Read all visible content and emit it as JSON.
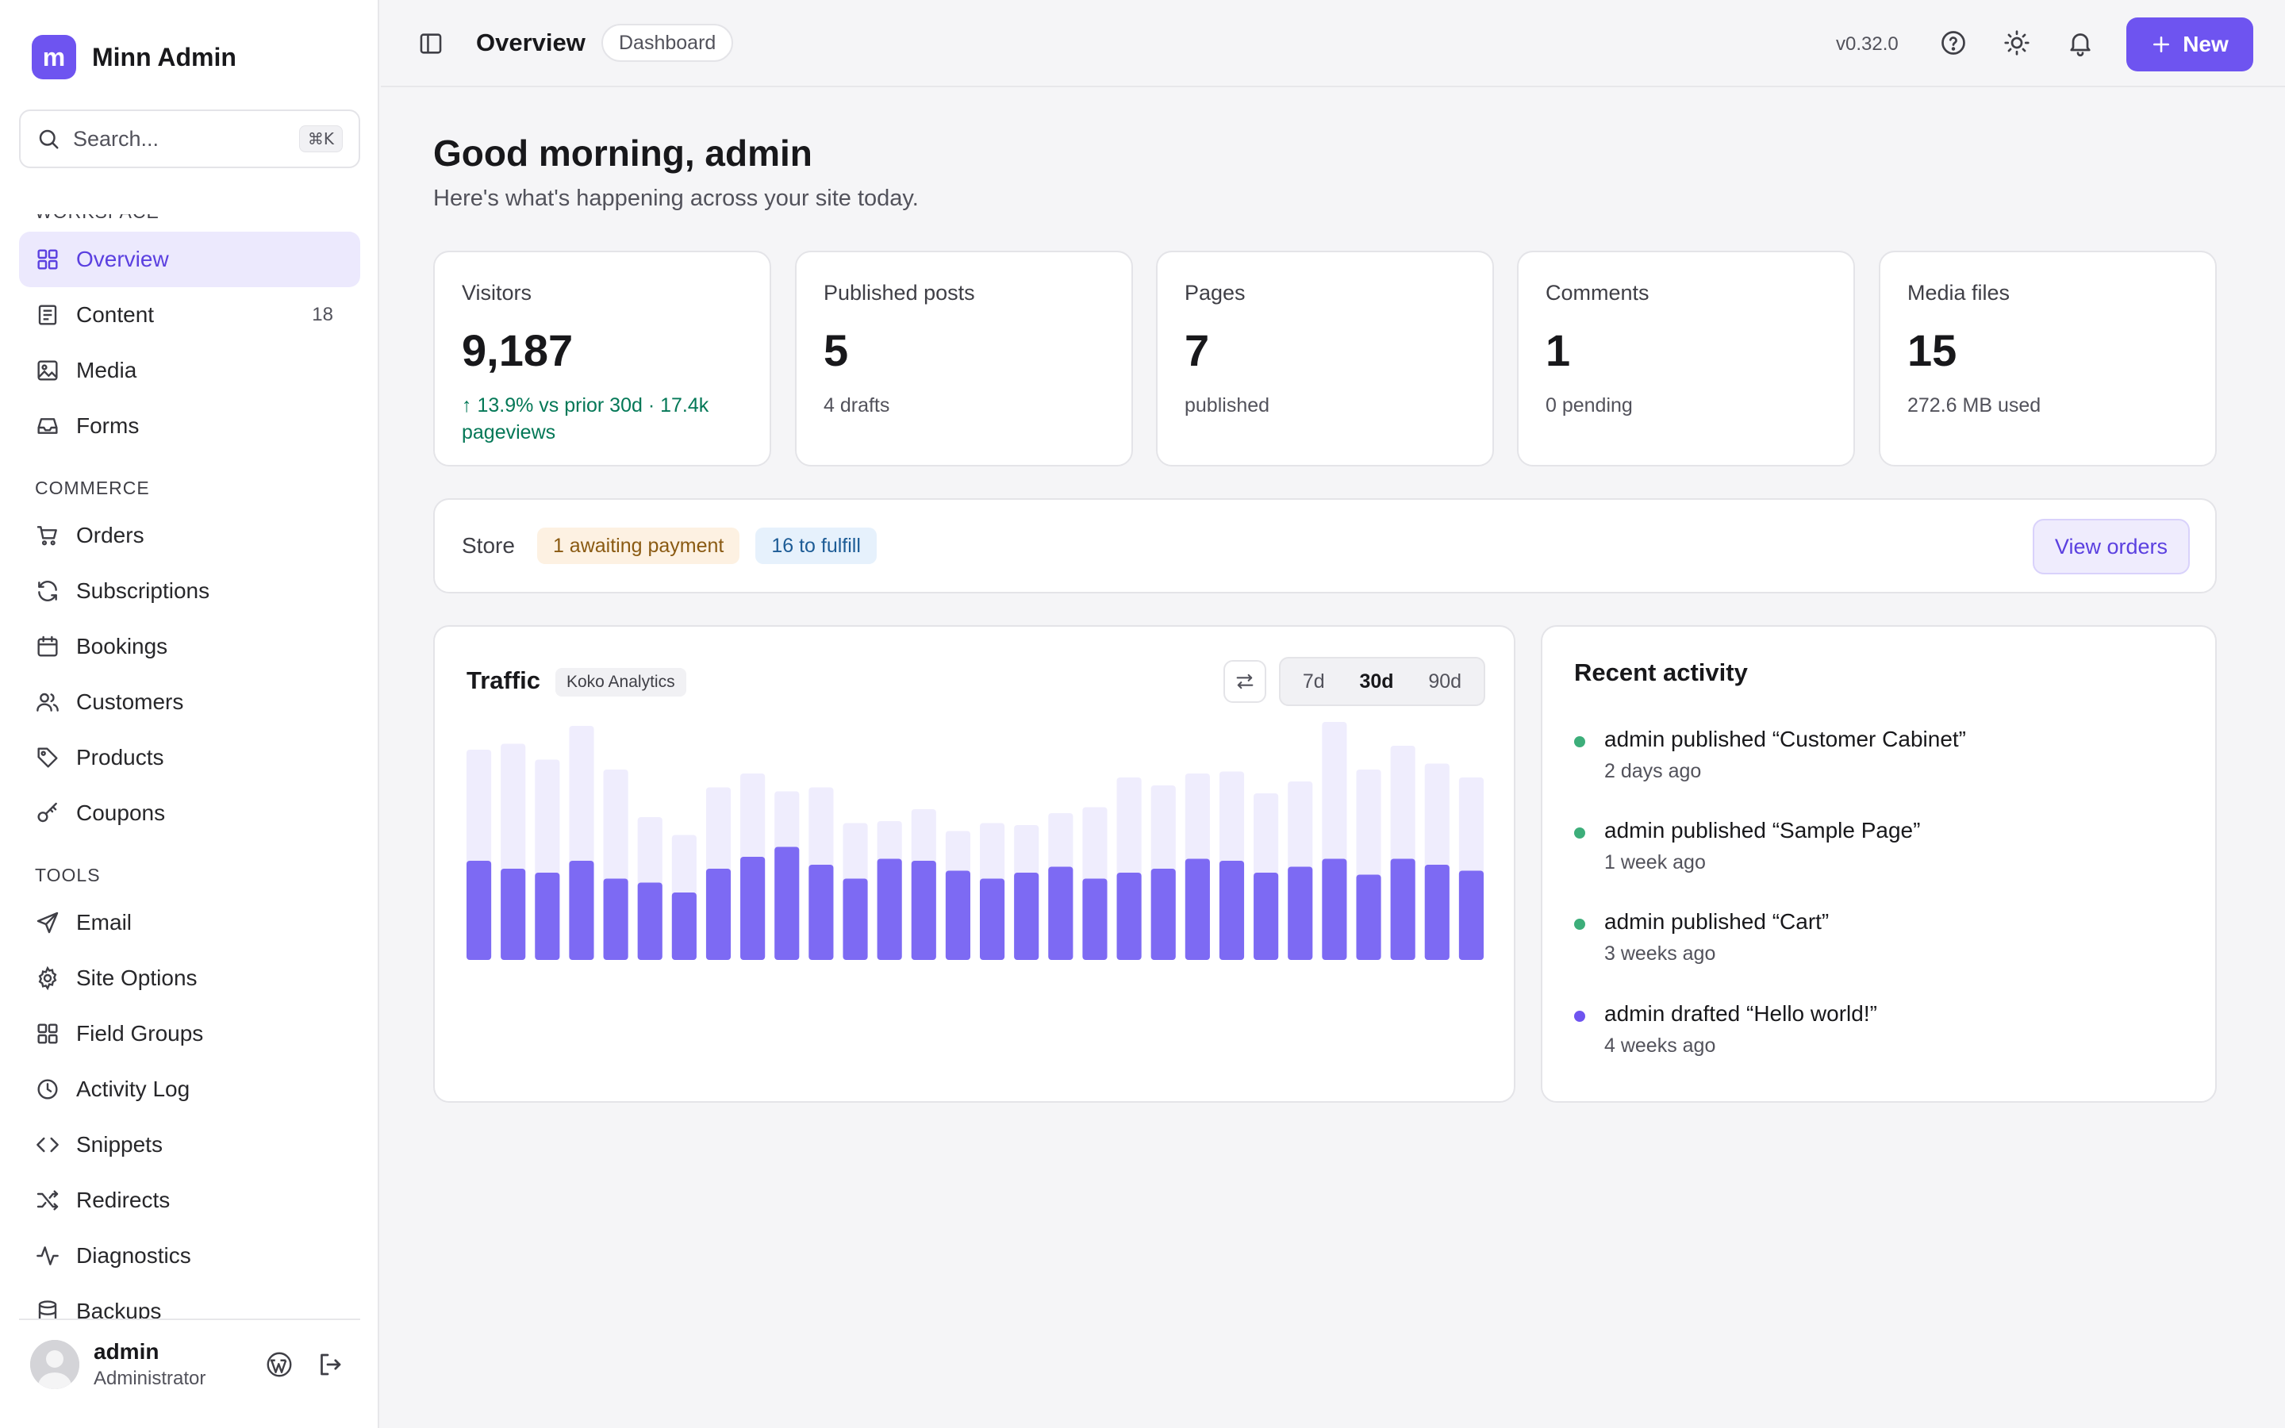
{
  "brand": {
    "logo_letter": "m",
    "name": "Minn Admin"
  },
  "search": {
    "placeholder": "Search...",
    "shortcut": "⌘K"
  },
  "sidebar": {
    "sections": [
      {
        "title": "WORKSPACE",
        "items": [
          {
            "label": "Overview",
            "icon": "grid-icon",
            "active": true
          },
          {
            "label": "Content",
            "icon": "document-icon",
            "count": "18"
          },
          {
            "label": "Media",
            "icon": "image-icon"
          },
          {
            "label": "Forms",
            "icon": "inbox-icon"
          }
        ]
      },
      {
        "title": "COMMERCE",
        "items": [
          {
            "label": "Orders",
            "icon": "cart-icon"
          },
          {
            "label": "Subscriptions",
            "icon": "refresh-icon"
          },
          {
            "label": "Bookings",
            "icon": "calendar-icon"
          },
          {
            "label": "Customers",
            "icon": "users-icon"
          },
          {
            "label": "Products",
            "icon": "tag-icon"
          },
          {
            "label": "Coupons",
            "icon": "key-icon"
          }
        ]
      },
      {
        "title": "TOOLS",
        "items": [
          {
            "label": "Email",
            "icon": "send-icon"
          },
          {
            "label": "Site Options",
            "icon": "gear-icon"
          },
          {
            "label": "Field Groups",
            "icon": "grid-icon"
          },
          {
            "label": "Activity Log",
            "icon": "clock-icon"
          },
          {
            "label": "Snippets",
            "icon": "code-icon"
          },
          {
            "label": "Redirects",
            "icon": "shuffle-icon"
          },
          {
            "label": "Diagnostics",
            "icon": "pulse-icon"
          },
          {
            "label": "Backups",
            "icon": "database-icon"
          }
        ]
      }
    ]
  },
  "user": {
    "name": "admin",
    "role": "Administrator"
  },
  "topbar": {
    "title": "Overview",
    "breadcrumb": "Dashboard",
    "version": "v0.32.0",
    "new_label": "New"
  },
  "greeting": {
    "title": "Good morning, admin",
    "subtitle": "Here's what's happening across your site today."
  },
  "stats": [
    {
      "label": "Visitors",
      "value": "9,187",
      "sub": "↑ 13.9% vs prior 30d · 17.4k pageviews",
      "positive": true
    },
    {
      "label": "Published posts",
      "value": "5",
      "sub": "4 drafts"
    },
    {
      "label": "Pages",
      "value": "7",
      "sub": "published"
    },
    {
      "label": "Comments",
      "value": "1",
      "sub": "0 pending"
    },
    {
      "label": "Media files",
      "value": "15",
      "sub": "272.6 MB used"
    }
  ],
  "store": {
    "label": "Store",
    "awaiting": "1 awaiting payment",
    "fulfill": "16 to fulfill",
    "view_orders": "View orders"
  },
  "traffic": {
    "title": "Traffic",
    "source": "Koko Analytics",
    "ranges": [
      "7d",
      "30d",
      "90d"
    ],
    "active_range": "30d"
  },
  "chart_data": {
    "type": "bar",
    "categories": [],
    "series": [
      {
        "values": [
          530,
          545,
          505,
          590,
          480,
          360,
          315,
          435,
          470,
          425,
          435,
          345,
          350,
          380,
          325,
          345,
          340,
          370,
          385,
          460,
          440,
          470,
          475,
          420,
          450,
          600,
          480,
          540,
          495,
          460
        ]
      },
      {
        "values": [
          250,
          230,
          220,
          250,
          205,
          195,
          170,
          230,
          260,
          285,
          240,
          205,
          255,
          250,
          225,
          205,
          220,
          235,
          205,
          220,
          230,
          255,
          250,
          220,
          235,
          255,
          215,
          255,
          240,
          225
        ]
      }
    ],
    "colors": [
      "#efedfd",
      "#7d6af3"
    ],
    "grid": false
  },
  "activity": {
    "title": "Recent activity",
    "items": [
      {
        "text": "admin published “Customer Cabinet”",
        "time": "2 days ago",
        "color": "#3dae7a"
      },
      {
        "text": "admin published “Sample Page”",
        "time": "1 week ago",
        "color": "#3dae7a"
      },
      {
        "text": "admin published “Cart”",
        "time": "3 weeks ago",
        "color": "#3dae7a"
      },
      {
        "text": "admin drafted “Hello world!”",
        "time": "4 weeks ago",
        "color": "#6e54f0"
      }
    ]
  }
}
